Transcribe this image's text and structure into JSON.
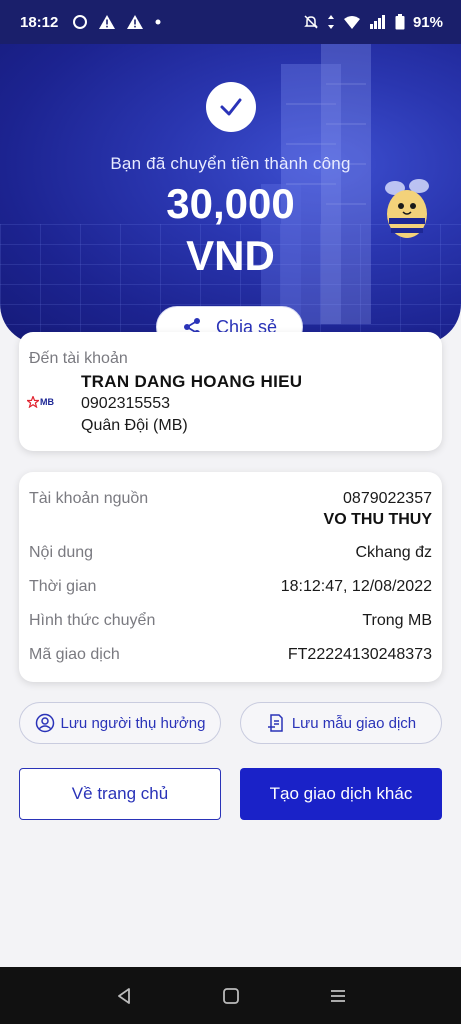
{
  "status_bar": {
    "time": "18:12",
    "battery": "91%"
  },
  "hero": {
    "message": "Bạn đã chuyển tiền thành công",
    "amount": "30,000",
    "currency": "VND",
    "share_label": "Chia sẻ"
  },
  "destination": {
    "label": "Đến tài khoản",
    "bank_logo_text": "MB",
    "name": "TRAN DANG HOANG HIEU",
    "account": "0902315553",
    "bank": "Quân Đội (MB)"
  },
  "details": {
    "source_label": "Tài khoản nguồn",
    "source_account": "0879022357",
    "source_name": "VO THU THUY",
    "content_label": "Nội dung",
    "content_value": "Ckhang đz",
    "time_label": "Thời gian",
    "time_value": "18:12:47, 12/08/2022",
    "method_label": "Hình thức chuyển",
    "method_value": "Trong MB",
    "txid_label": "Mã giao dịch",
    "txid_value": "FT22224130248373"
  },
  "actions": {
    "save_recipient": "Lưu người thụ hưởng",
    "save_template": "Lưu mẫu giao dịch",
    "home": "Về trang chủ",
    "new_transaction": "Tạo giao dịch khác"
  },
  "colors": {
    "primary": "#1a22c8",
    "hero_bg": "#1c2390",
    "accent_text": "#2a33b8"
  }
}
